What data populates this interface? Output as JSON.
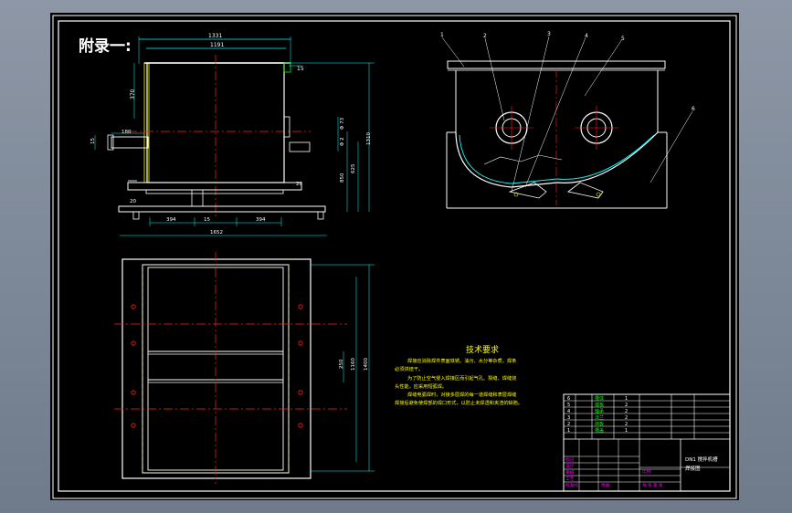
{
  "title_heading": "附录一:",
  "view_front": {
    "dim_top_outer": "1331",
    "dim_top_inner": "1191",
    "dim_left_height": "370",
    "dim_flange": "15",
    "dim_left_small": "180",
    "dim_side_15": "15",
    "dim_r1": "Φ 73",
    "dim_r2": "Φ 2",
    "dim_r3": "625",
    "dim_r4": "850",
    "dim_total_h": "1310",
    "dim_bottom_20a": "20",
    "dim_bottom_20b": "20",
    "dim_seg1": "394",
    "dim_seg2": "15",
    "dim_seg3": "394",
    "dim_total_w": "1652"
  },
  "view_side": {
    "callouts": [
      "1",
      "2",
      "3",
      "4",
      "5",
      "6"
    ]
  },
  "view_plan": {
    "dim_mid": "250",
    "dim_inner": "1160",
    "dim_outer": "1400"
  },
  "tech": {
    "title": "技术要求",
    "lines": [
      "焊接应消除焊件表面铁锈、油污、水分等杂质，焊条",
      "必须烘焙干。",
      "为了防止空气侵入焊接区而引起气孔、裂缝、焊缝烧",
      "头性能，应采用短弧焊。",
      "焊缝电弧焊时，对接多层焊的每一道焊缝和表层焊缝",
      "焊接后避免使焊部的焊口形式，以防止未焊透和夹渣的缺陷。"
    ]
  },
  "title_block": {
    "drawing_name_1": "DN1 搅拌机槽",
    "drawing_name_2": "焊接图",
    "parts": [
      {
        "no": "6",
        "name": "槽体",
        "qty": "1"
      },
      {
        "no": "5",
        "name": "端板",
        "qty": "2"
      },
      {
        "no": "4",
        "name": "轴承",
        "qty": "2"
      },
      {
        "no": "3",
        "name": "法兰",
        "qty": "2"
      },
      {
        "no": "2",
        "name": "挡板",
        "qty": "2"
      },
      {
        "no": "1",
        "name": "槽盖",
        "qty": "1"
      }
    ],
    "row_labels": [
      "标记",
      "设计",
      "审核",
      "工艺",
      "标准化",
      "批准"
    ],
    "scale_label": "比例",
    "sheet_label": "共 张 第 张"
  }
}
